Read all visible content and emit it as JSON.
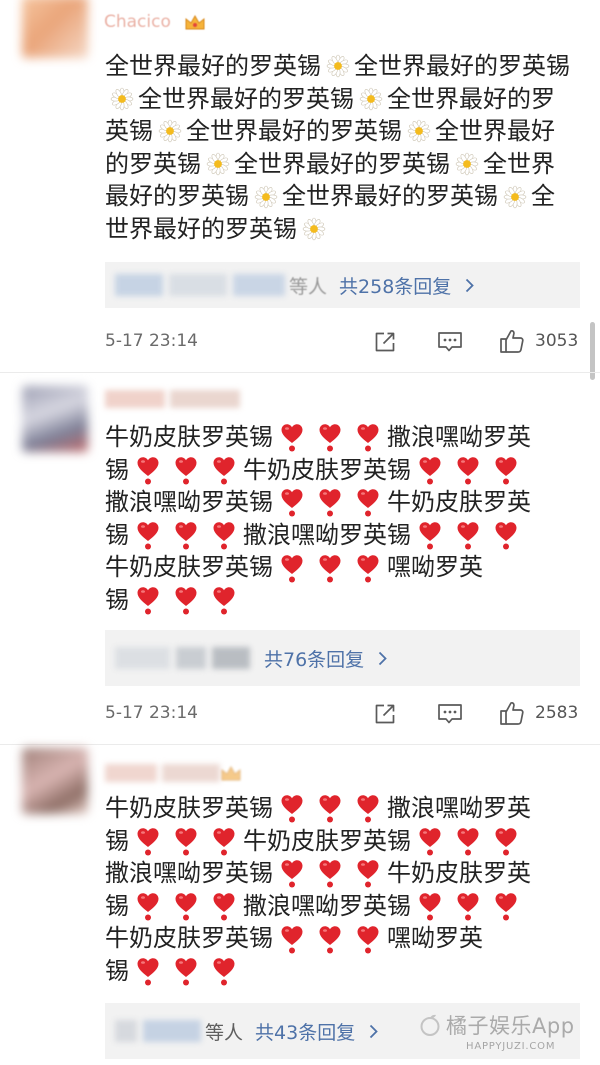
{
  "comments": [
    {
      "username": "Chacico",
      "lines": [
        [
          {
            "text": "全世界最好的罗英锡"
          },
          {
            "icon": "daisy-icon"
          },
          {
            "text": "全世界最好的罗英锡"
          }
        ],
        [
          {
            "icon": "daisy-icon"
          },
          {
            "text": "全世界最好的罗英锡"
          },
          {
            "icon": "daisy-icon"
          },
          {
            "text": "全世界最好的罗"
          }
        ],
        [
          {
            "text": "英锡"
          },
          {
            "icon": "daisy-icon"
          },
          {
            "text": "全世界最好的罗英锡"
          },
          {
            "icon": "daisy-icon"
          },
          {
            "text": "全世界最好"
          }
        ],
        [
          {
            "text": "的罗英锡"
          },
          {
            "icon": "daisy-icon"
          },
          {
            "text": "全世界最好的罗英锡"
          },
          {
            "icon": "daisy-icon"
          },
          {
            "text": "全世界"
          }
        ],
        [
          {
            "text": "最好的罗英锡"
          },
          {
            "icon": "daisy-icon"
          },
          {
            "text": "全世界最好的罗英锡"
          },
          {
            "icon": "daisy-icon"
          },
          {
            "text": "全"
          }
        ],
        [
          {
            "text": "世界最好的罗英锡"
          },
          {
            "icon": "daisy-icon"
          }
        ]
      ],
      "replies": {
        "prefix": "等人",
        "summary": "共258条回复"
      },
      "time": "5-17 23:14",
      "likes": "3053"
    },
    {
      "lines": [
        [
          {
            "text": "牛奶皮肤罗英锡"
          },
          {
            "icon": "heart-exclamation-icon"
          },
          {
            "icon": "heart-exclamation-icon"
          },
          {
            "icon": "heart-exclamation-icon"
          },
          {
            "text": "撒浪嘿呦罗英"
          }
        ],
        [
          {
            "text": "锡"
          },
          {
            "icon": "heart-exclamation-icon"
          },
          {
            "icon": "heart-exclamation-icon"
          },
          {
            "icon": "heart-exclamation-icon"
          },
          {
            "text": "牛奶皮肤罗英锡"
          },
          {
            "icon": "heart-exclamation-icon"
          },
          {
            "icon": "heart-exclamation-icon"
          },
          {
            "icon": "heart-exclamation-icon"
          }
        ],
        [
          {
            "text": "撒浪嘿呦罗英锡"
          },
          {
            "icon": "heart-exclamation-icon"
          },
          {
            "icon": "heart-exclamation-icon"
          },
          {
            "icon": "heart-exclamation-icon"
          },
          {
            "text": "牛奶皮肤罗英"
          }
        ],
        [
          {
            "text": "锡"
          },
          {
            "icon": "heart-exclamation-icon"
          },
          {
            "icon": "heart-exclamation-icon"
          },
          {
            "icon": "heart-exclamation-icon"
          },
          {
            "text": "撒浪嘿呦罗英锡"
          },
          {
            "icon": "heart-exclamation-icon"
          },
          {
            "icon": "heart-exclamation-icon"
          },
          {
            "icon": "heart-exclamation-icon"
          }
        ],
        [
          {
            "text": "牛奶皮肤罗英锡"
          },
          {
            "icon": "heart-exclamation-icon"
          },
          {
            "icon": "heart-exclamation-icon"
          },
          {
            "icon": "heart-exclamation-icon"
          },
          {
            "text": "嘿呦罗英"
          }
        ],
        [
          {
            "text": "锡"
          },
          {
            "icon": "heart-exclamation-icon"
          },
          {
            "icon": "heart-exclamation-icon"
          },
          {
            "icon": "heart-exclamation-icon"
          }
        ]
      ],
      "replies": {
        "summary": "共76条回复"
      },
      "time": "5-17 23:14",
      "likes": "2583"
    },
    {
      "lines": [
        [
          {
            "text": "牛奶皮肤罗英锡"
          },
          {
            "icon": "heart-exclamation-icon"
          },
          {
            "icon": "heart-exclamation-icon"
          },
          {
            "icon": "heart-exclamation-icon"
          },
          {
            "text": "撒浪嘿呦罗英"
          }
        ],
        [
          {
            "text": "锡"
          },
          {
            "icon": "heart-exclamation-icon"
          },
          {
            "icon": "heart-exclamation-icon"
          },
          {
            "icon": "heart-exclamation-icon"
          },
          {
            "text": "牛奶皮肤罗英锡"
          },
          {
            "icon": "heart-exclamation-icon"
          },
          {
            "icon": "heart-exclamation-icon"
          },
          {
            "icon": "heart-exclamation-icon"
          }
        ],
        [
          {
            "text": "撒浪嘿呦罗英锡"
          },
          {
            "icon": "heart-exclamation-icon"
          },
          {
            "icon": "heart-exclamation-icon"
          },
          {
            "icon": "heart-exclamation-icon"
          },
          {
            "text": "牛奶皮肤罗英"
          }
        ],
        [
          {
            "text": "锡"
          },
          {
            "icon": "heart-exclamation-icon"
          },
          {
            "icon": "heart-exclamation-icon"
          },
          {
            "icon": "heart-exclamation-icon"
          },
          {
            "text": "撒浪嘿呦罗英锡"
          },
          {
            "icon": "heart-exclamation-icon"
          },
          {
            "icon": "heart-exclamation-icon"
          },
          {
            "icon": "heart-exclamation-icon"
          }
        ],
        [
          {
            "text": "牛奶皮肤罗英锡"
          },
          {
            "icon": "heart-exclamation-icon"
          },
          {
            "icon": "heart-exclamation-icon"
          },
          {
            "icon": "heart-exclamation-icon"
          },
          {
            "text": "嘿呦罗英"
          }
        ],
        [
          {
            "text": "锡"
          },
          {
            "icon": "heart-exclamation-icon"
          },
          {
            "icon": "heart-exclamation-icon"
          },
          {
            "icon": "heart-exclamation-icon"
          }
        ]
      ],
      "replies": {
        "prefix": "等人",
        "summary": "共43条回复"
      }
    }
  ],
  "watermark": {
    "name": "橘子娱乐App",
    "url": "HAPPYJUZI.COM"
  },
  "colors": {
    "text": "#222222",
    "link": "#4e72a8",
    "meta": "#6a6a6a",
    "heart": "#e0242c",
    "daisy_center": "#f4bb1e",
    "reply_bg": "#f2f2f2"
  }
}
